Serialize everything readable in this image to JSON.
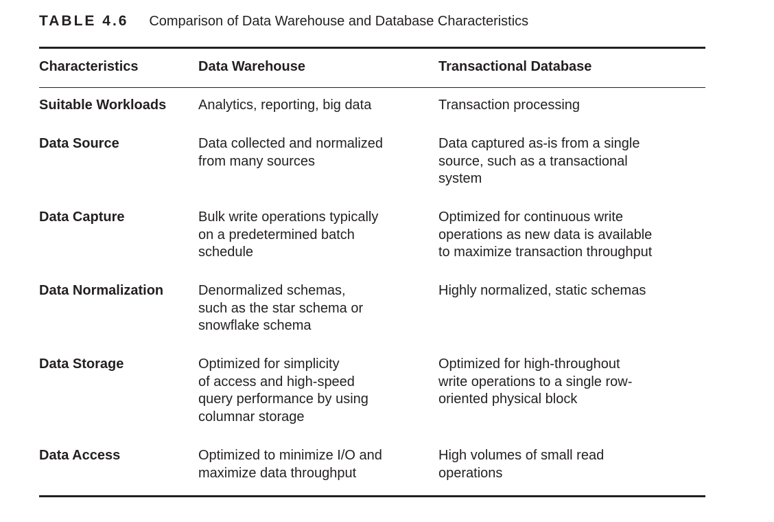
{
  "table": {
    "label": "TABLE 4.6",
    "title": "Comparison of Data Warehouse and Database Characteristics",
    "headers": [
      "Characteristics",
      "Data Warehouse",
      "Transactional Database"
    ],
    "rows": [
      {
        "characteristic": "Suitable Workloads",
        "warehouse": [
          "Analytics, reporting, big data"
        ],
        "database": [
          "Transaction processing"
        ]
      },
      {
        "characteristic": "Data Source",
        "warehouse": [
          "Data collected and normalized",
          "from many sources"
        ],
        "database": [
          "Data captured as-is from a single",
          "source, such as a transactional",
          "system"
        ]
      },
      {
        "characteristic": "Data Capture",
        "warehouse": [
          "Bulk write operations typically",
          "on a predetermined batch",
          "schedule"
        ],
        "database": [
          "Optimized for continuous write",
          "operations as new data is available",
          "to maximize transaction throughput"
        ]
      },
      {
        "characteristic": "Data Normalization",
        "warehouse": [
          "Denormalized schemas,",
          "such as the star schema or",
          "snowflake schema"
        ],
        "database": [
          "Highly normalized, static schemas"
        ]
      },
      {
        "characteristic": "Data Storage",
        "warehouse": [
          "Optimized for simplicity",
          "of access and high-speed",
          "query performance by using",
          "columnar storage"
        ],
        "database": [
          "Optimized for high-throughout",
          "write operations to a single row-",
          "oriented physical block"
        ]
      },
      {
        "characteristic": "Data Access",
        "warehouse": [
          "Optimized to minimize I/O and",
          "maximize data throughput"
        ],
        "database": [
          "High volumes of small read",
          "operations"
        ]
      }
    ]
  }
}
